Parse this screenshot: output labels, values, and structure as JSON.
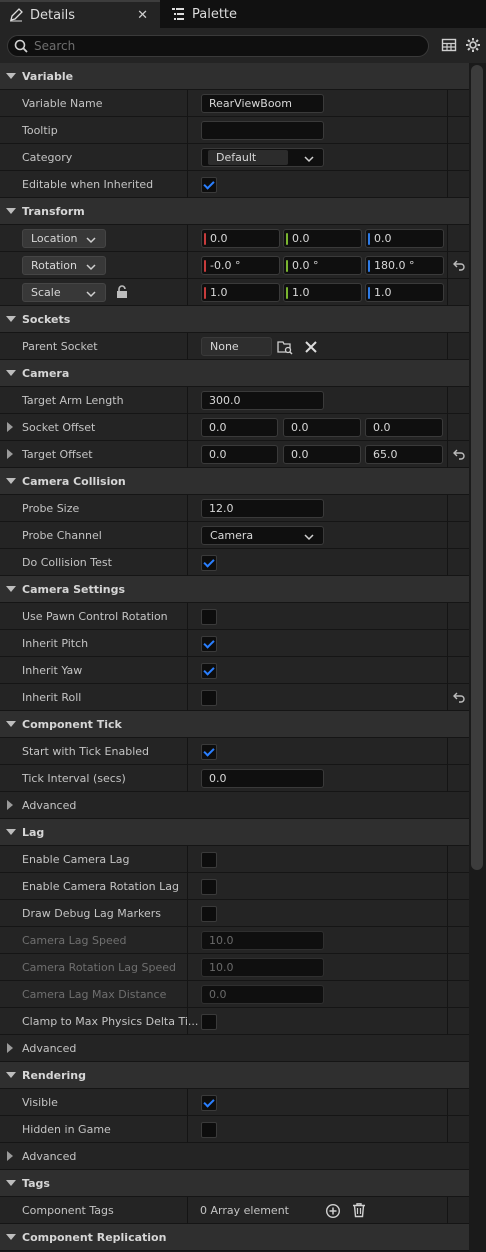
{
  "tabs": [
    {
      "label": "Details",
      "icon": "pencil-icon"
    },
    {
      "label": "Palette",
      "icon": "list-icon"
    }
  ],
  "search": {
    "placeholder": "Search"
  },
  "categories": {
    "variable": "Variable",
    "transform": "Transform",
    "sockets": "Sockets",
    "camera": "Camera",
    "camera_collision": "Camera Collision",
    "camera_settings": "Camera Settings",
    "component_tick": "Component Tick",
    "lag": "Lag",
    "rendering": "Rendering",
    "tags": "Tags",
    "component_replication": "Component Replication"
  },
  "variable": {
    "name_label": "Variable Name",
    "name_value": "RearViewBoom",
    "tooltip_label": "Tooltip",
    "tooltip_value": "",
    "category_label": "Category",
    "category_value": "Default",
    "editable_label": "Editable when Inherited",
    "editable_checked": true
  },
  "transform": {
    "location": {
      "label": "Location",
      "x": "0.0",
      "y": "0.0",
      "z": "0.0"
    },
    "rotation": {
      "label": "Rotation",
      "x": "-0.0 °",
      "y": "0.0 °",
      "z": "180.0 °"
    },
    "scale": {
      "label": "Scale",
      "x": "1.0",
      "y": "1.0",
      "z": "1.0"
    }
  },
  "sockets": {
    "parent_label": "Parent Socket",
    "parent_value": "None"
  },
  "camera": {
    "arm_label": "Target Arm Length",
    "arm_value": "300.0",
    "socket_offset_label": "Socket Offset",
    "socket_offset": [
      "0.0",
      "0.0",
      "0.0"
    ],
    "target_offset_label": "Target Offset",
    "target_offset": [
      "0.0",
      "0.0",
      "65.0"
    ]
  },
  "collision": {
    "probe_size_label": "Probe Size",
    "probe_size_value": "12.0",
    "probe_channel_label": "Probe Channel",
    "probe_channel_value": "Camera",
    "do_test_label": "Do Collision Test",
    "do_test_checked": true
  },
  "camera_settings": {
    "pawn_label": "Use Pawn Control Rotation",
    "pawn_checked": false,
    "pitch_label": "Inherit Pitch",
    "pitch_checked": true,
    "yaw_label": "Inherit Yaw",
    "yaw_checked": true,
    "roll_label": "Inherit Roll",
    "roll_checked": false
  },
  "tick": {
    "start_label": "Start with Tick Enabled",
    "start_checked": true,
    "interval_label": "Tick Interval (secs)",
    "interval_value": "0.0",
    "advanced_label": "Advanced"
  },
  "lag": {
    "enable_label": "Enable Camera Lag",
    "enable_rot_label": "Enable Camera Rotation Lag",
    "debug_label": "Draw Debug Lag Markers",
    "speed_label": "Camera Lag Speed",
    "speed_value": "10.0",
    "rot_speed_label": "Camera Rotation Lag Speed",
    "rot_speed_value": "10.0",
    "max_dist_label": "Camera Lag Max Distance",
    "max_dist_value": "0.0",
    "clamp_label": "Clamp to Max Physics Delta Ti...",
    "advanced_label": "Advanced"
  },
  "rendering": {
    "visible_label": "Visible",
    "visible_checked": true,
    "hidden_label": "Hidden in Game",
    "hidden_checked": false,
    "advanced_label": "Advanced"
  },
  "tags": {
    "component_tags_label": "Component Tags",
    "component_tags_value": "0 Array element"
  },
  "colors": {
    "x_axis": "#c83c3c",
    "y_axis": "#7ab530",
    "z_axis": "#2d7be6",
    "check": "#2a7fff"
  }
}
